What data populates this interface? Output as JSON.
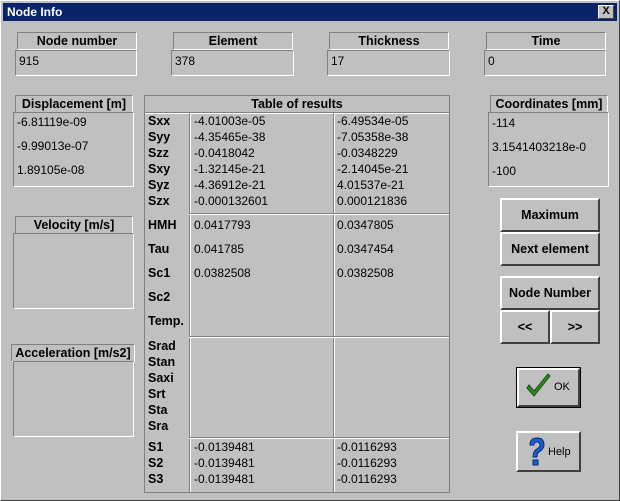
{
  "window": {
    "title": "Node Info",
    "close_glyph": "X"
  },
  "top": {
    "node_number": {
      "label": "Node number",
      "value": "915"
    },
    "element": {
      "label": "Element",
      "value": "378"
    },
    "thickness": {
      "label": "Thickness",
      "value": "17"
    },
    "time": {
      "label": "Time",
      "value": "0"
    }
  },
  "displacement": {
    "label": "Displacement [m]",
    "values": [
      "-6.81119e-09",
      "-9.99013e-07",
      "1.89105e-08"
    ]
  },
  "velocity": {
    "label": "Velocity [m/s]"
  },
  "acceleration": {
    "label": "Acceleration [m/s2]"
  },
  "coordinates": {
    "label": "Coordinates [mm]",
    "values": [
      "-114",
      "3.1541403218e-0",
      "-100"
    ]
  },
  "table": {
    "title": "Table of results",
    "stress_rows": [
      {
        "name": "Sxx",
        "c1": "-4.01003e-05",
        "c2": "-6.49534e-05"
      },
      {
        "name": "Syy",
        "c1": "-4.35465e-38",
        "c2": "-7.05358e-38"
      },
      {
        "name": "Szz",
        "c1": "-0.0418042",
        "c2": "-0.0348229"
      },
      {
        "name": "Sxy",
        "c1": "-1.32145e-21",
        "c2": "-2.14045e-21"
      },
      {
        "name": "Syz",
        "c1": "-4.36912e-21",
        "c2": "4.01537e-21"
      },
      {
        "name": "Szx",
        "c1": "-0.000132601",
        "c2": "0.000121836"
      }
    ],
    "mid_rows": [
      {
        "name": "HMH",
        "c1": "0.0417793",
        "c2": "0.0347805"
      },
      {
        "name": "Tau",
        "c1": "0.041785",
        "c2": "0.0347454"
      },
      {
        "name": "Sc1",
        "c1": "0.0382508",
        "c2": "0.0382508"
      },
      {
        "name": "Sc2",
        "c1": "",
        "c2": ""
      },
      {
        "name": "Temp.",
        "c1": "",
        "c2": ""
      }
    ],
    "radial_rows": [
      "Srad",
      "Stan",
      "Saxi",
      "Srt",
      "Sta",
      "Sra"
    ],
    "principal_rows": [
      {
        "name": "S1",
        "c1": "-0.0139481",
        "c2": "-0.0116293"
      },
      {
        "name": "S2",
        "c1": "-0.0139481",
        "c2": "-0.0116293"
      },
      {
        "name": "S3",
        "c1": "-0.0139481",
        "c2": "-0.0116293"
      }
    ]
  },
  "buttons": {
    "maximum": "Maximum",
    "next_element": "Next element",
    "node_number": "Node Number",
    "prev": "<<",
    "next": ">>",
    "ok": "OK",
    "help": "Help"
  },
  "colors": {
    "titlebar": "#0a246a",
    "ok_check": "#2e8b22",
    "help_q": "#1a5fd0"
  }
}
